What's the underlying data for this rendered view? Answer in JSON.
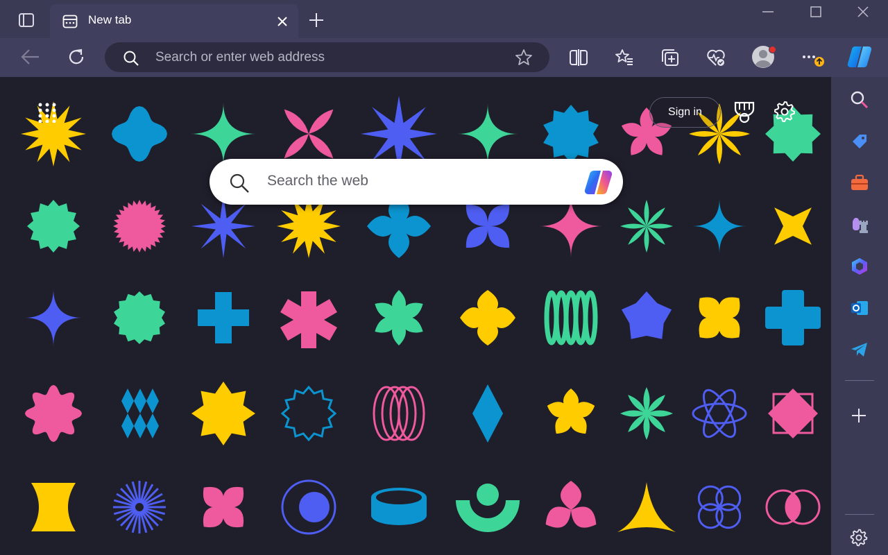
{
  "window": {
    "tab": {
      "title": "New tab"
    },
    "controls": [
      "minimize",
      "maximize",
      "close"
    ]
  },
  "toolbar": {
    "address_placeholder": "Search or enter web address",
    "icons": [
      "back-icon",
      "refresh-icon",
      "search-icon",
      "favorite-star-icon",
      "split-screen-icon",
      "favorites-icon",
      "collections-icon",
      "browser-essentials-icon",
      "profile-avatar",
      "more-menu-icon",
      "copilot-icon"
    ]
  },
  "newtab": {
    "search_placeholder": "Search the web",
    "signin_label": "Sign in",
    "icons": [
      "app-launcher-icon",
      "rewards-trophy-icon",
      "settings-gear-icon",
      "copilot-icon"
    ],
    "palette": {
      "yellow": "#ffcc00",
      "blue": "#0b94cf",
      "green": "#3ed598",
      "pink": "#ee5a9d",
      "indigo": "#4f5ef2"
    }
  },
  "sidebar": {
    "icons": [
      "search-icon",
      "shopping-tag-icon",
      "tools-briefcase-icon",
      "games-icon",
      "microsoft365-icon",
      "outlook-icon",
      "telegram-icon",
      "add-icon",
      "settings-gear-icon"
    ]
  },
  "colors": {
    "titlebar": "#3b3a55",
    "toolbar": "#403f5e",
    "background": "#1f1e2b",
    "accent": "#fbb316"
  }
}
